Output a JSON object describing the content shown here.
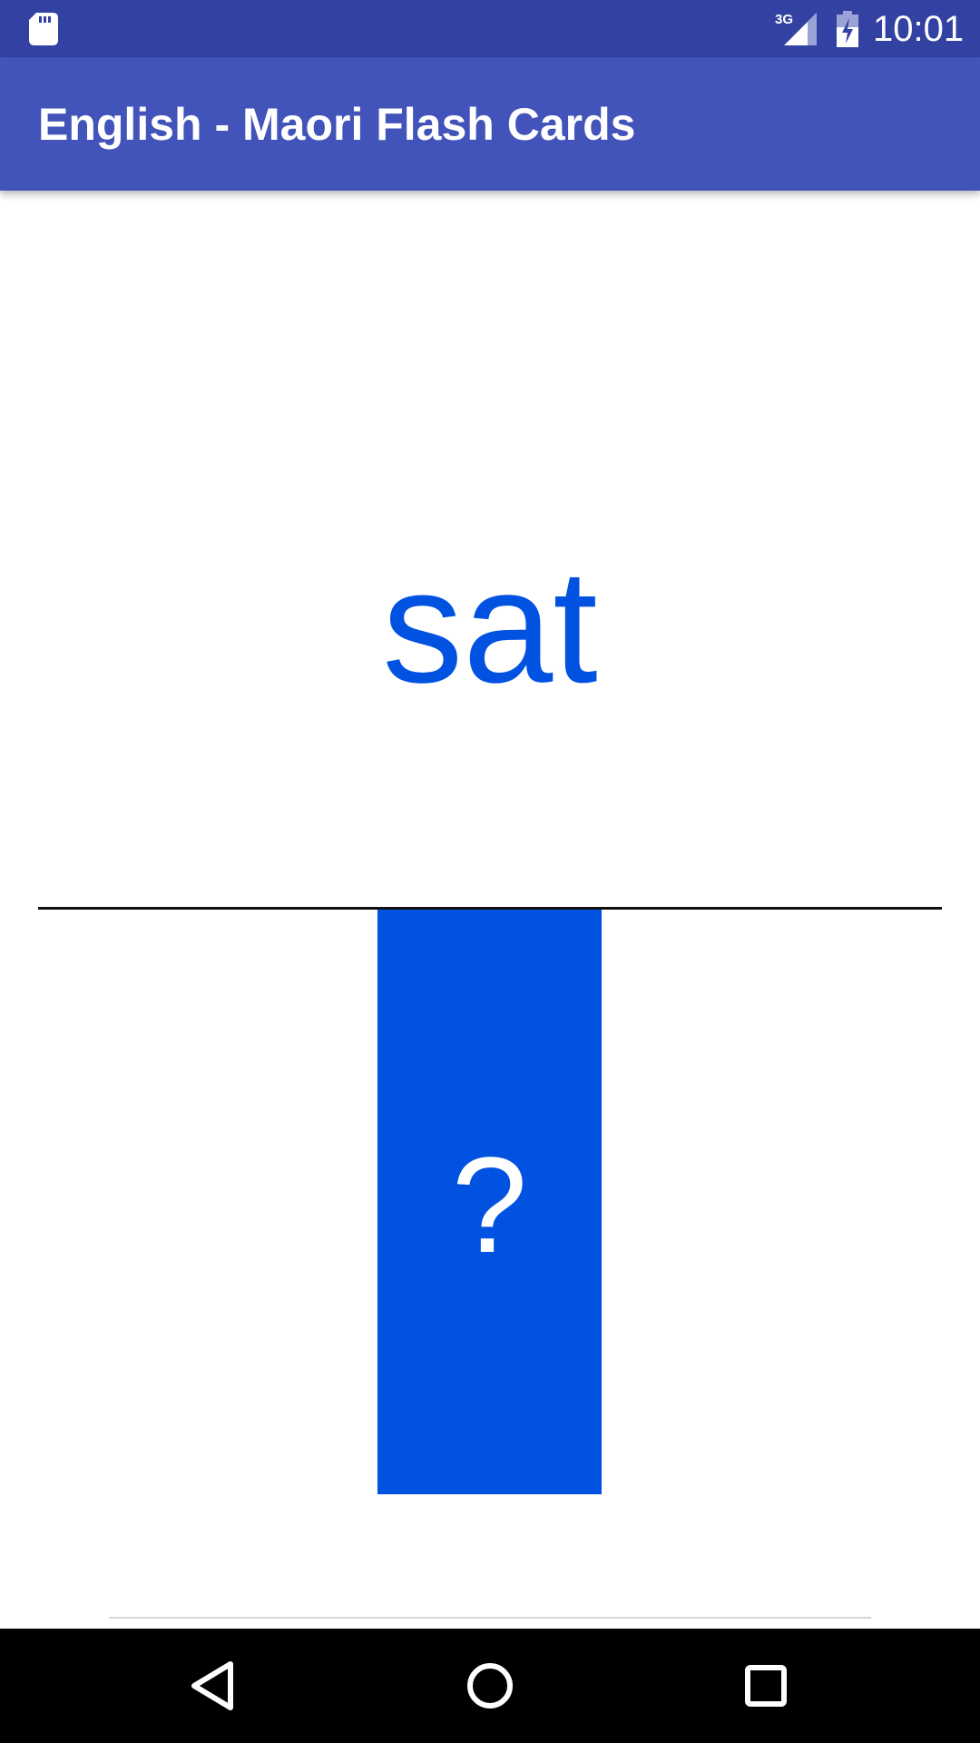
{
  "status_bar": {
    "time": "10:01",
    "network_label": "3G",
    "icons": [
      "sd-card-icon",
      "signal-3g-icon",
      "battery-charging-icon"
    ],
    "color": "#3342a2"
  },
  "app_bar": {
    "title": "English - Maori Flash Cards",
    "color": "#4253b9"
  },
  "card": {
    "word": "sat",
    "answer_placeholder": "?",
    "accent_color": "#0252e2"
  },
  "nav_bar": {
    "icons": [
      "back-icon",
      "home-icon",
      "recent-apps-icon"
    ]
  }
}
